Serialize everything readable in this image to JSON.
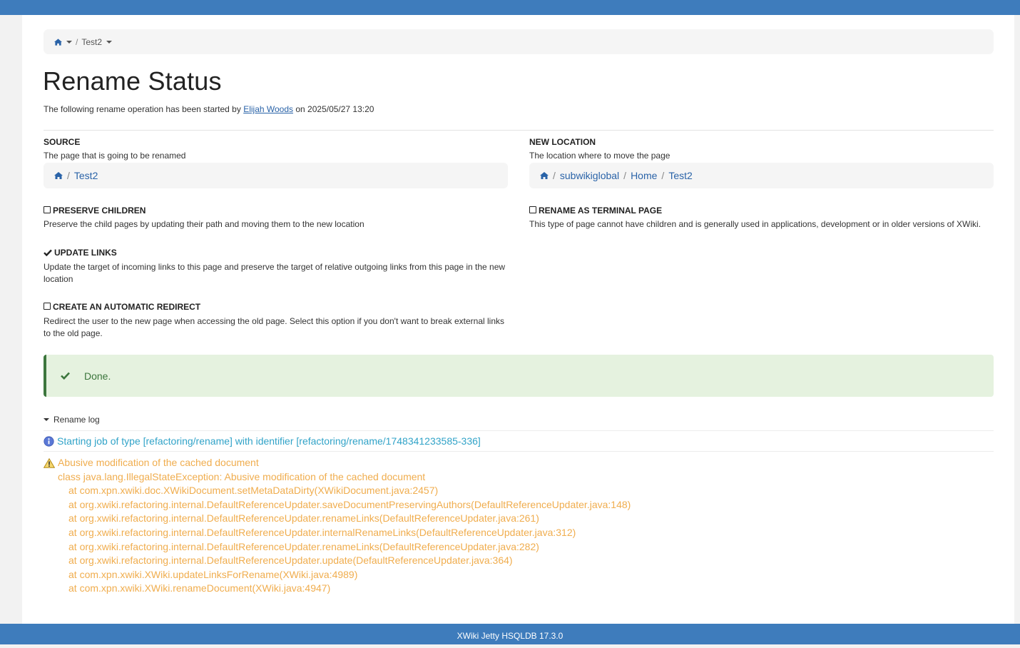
{
  "breadcrumb": {
    "home_icon": "home-icon",
    "current": "Test2"
  },
  "page": {
    "title": "Rename Status",
    "started_prefix": "The following rename operation has been started by",
    "started_user": "Elijah Woods",
    "started_suffix": "on 2025/05/27 13:20"
  },
  "source": {
    "title": "SOURCE",
    "description": "The page that is going to be renamed",
    "path": [
      "Test2"
    ]
  },
  "new_location": {
    "title": "NEW LOCATION",
    "description": "The location where to move the page",
    "path": [
      "subwikiglobal",
      "Home",
      "Test2"
    ]
  },
  "options": {
    "preserve_children": {
      "title": "PRESERVE CHILDREN",
      "checked": false,
      "description": "Preserve the child pages by updating their path and moving them to the new location"
    },
    "terminal_page": {
      "title": "RENAME AS TERMINAL PAGE",
      "checked": false,
      "description": "This type of page cannot have children and is generally used in applications, development or in older versions of XWiki."
    },
    "update_links": {
      "title": "UPDATE LINKS",
      "checked": true,
      "description": "Update the target of incoming links to this page and preserve the target of relative outgoing links from this page in the new location"
    },
    "auto_redirect": {
      "title": "CREATE AN AUTOMATIC REDIRECT",
      "checked": false,
      "description": "Redirect the user to the new page when accessing the old page. Select this option if you don't want to break external links to the old page."
    }
  },
  "status": {
    "message": "Done.",
    "color": "#3c763d",
    "background": "#e5f2df"
  },
  "log": {
    "toggle_label": "Rename log",
    "info": "Starting job of type [refactoring/rename] with identifier [refactoring/rename/1748341233585-336]",
    "warning": "Abusive modification of the cached document",
    "exception": "class java.lang.IllegalStateException: Abusive modification of the cached document",
    "stack": [
      "at com.xpn.xwiki.doc.XWikiDocument.setMetaDataDirty(XWikiDocument.java:2457)",
      "at org.xwiki.refactoring.internal.DefaultReferenceUpdater.saveDocumentPreservingAuthors(DefaultReferenceUpdater.java:148)",
      "at org.xwiki.refactoring.internal.DefaultReferenceUpdater.renameLinks(DefaultReferenceUpdater.java:261)",
      "at org.xwiki.refactoring.internal.DefaultReferenceUpdater.internalRenameLinks(DefaultReferenceUpdater.java:312)",
      "at org.xwiki.refactoring.internal.DefaultReferenceUpdater.renameLinks(DefaultReferenceUpdater.java:282)",
      "at org.xwiki.refactoring.internal.DefaultReferenceUpdater.update(DefaultReferenceUpdater.java:364)",
      "at com.xpn.xwiki.XWiki.updateLinksForRename(XWiki.java:4989)",
      "at com.xpn.xwiki.XWiki.renameDocument(XWiki.java:4947)"
    ],
    "info_color": "#31a3c8",
    "warning_color": "#f0ad4e"
  },
  "footer": {
    "text": "XWiki Jetty HSQLDB 17.3.0"
  },
  "theme": {
    "brand": "#3e7cbc",
    "link": "#2a63a8"
  }
}
